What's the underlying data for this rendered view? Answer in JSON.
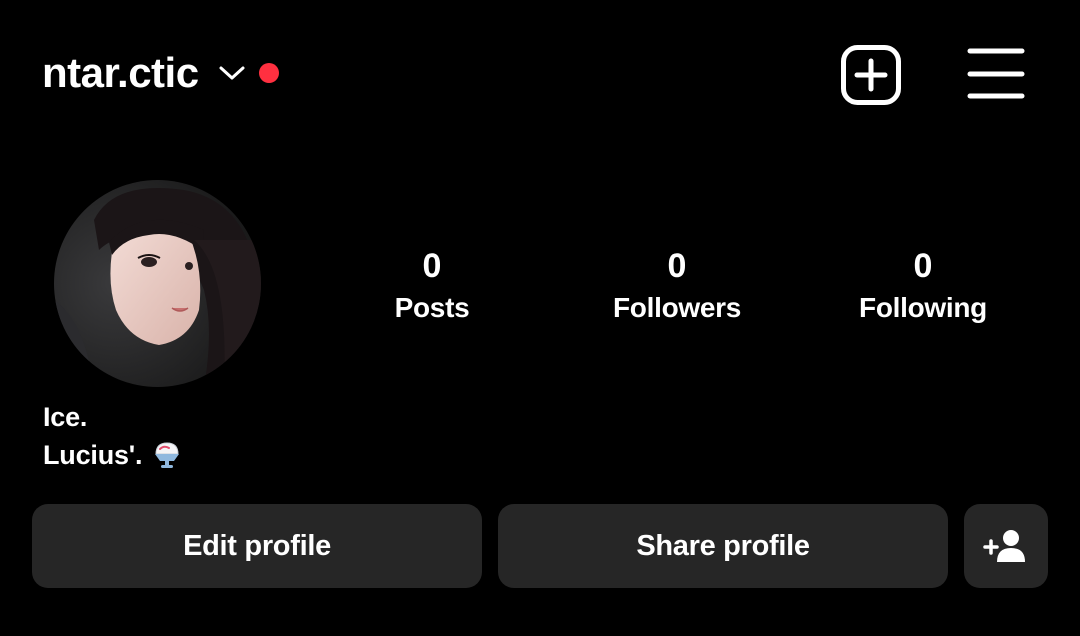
{
  "header": {
    "username": "ntar.ctic",
    "icons": {
      "account_switcher": "chevron-down-icon",
      "notification": "notification-dot",
      "create": "plus-square-icon",
      "menu": "hamburger-menu-icon"
    },
    "notification_color": "#ff3040"
  },
  "profile": {
    "avatar_icon": "profile-photo",
    "stats": [
      {
        "value": "0",
        "label": "Posts"
      },
      {
        "value": "0",
        "label": "Followers"
      },
      {
        "value": "0",
        "label": "Following"
      }
    ],
    "bio": {
      "name": "Ice.",
      "line2": "Lucius'.",
      "emoji_icon": "shaved-ice-emoji"
    }
  },
  "actions": {
    "edit_label": "Edit profile",
    "share_label": "Share profile",
    "add_person_icon": "add-person-icon",
    "button_color": "#262626"
  },
  "colors": {
    "background": "#000000",
    "text": "#ffffff"
  }
}
